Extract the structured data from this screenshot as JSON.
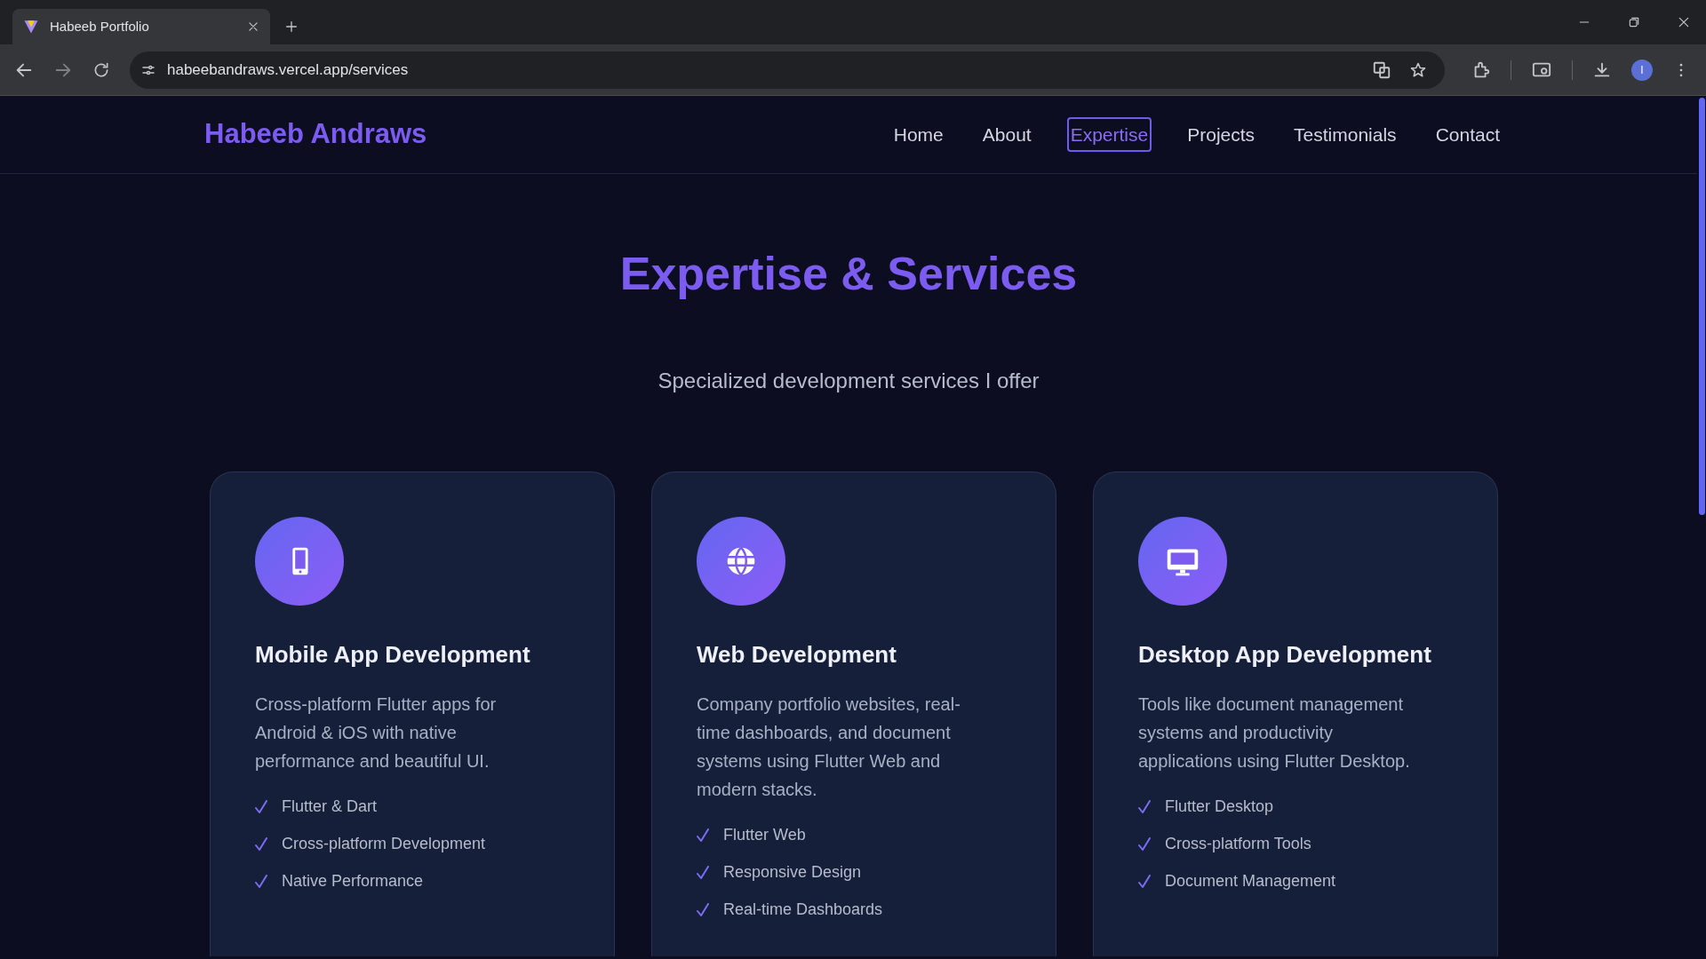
{
  "browser": {
    "tab": {
      "title": "Habeeb Portfolio",
      "selected": true
    },
    "url": "habeebandraws.vercel.app/services",
    "profile_initial": "I"
  },
  "site": {
    "logo": "Habeeb Andraws",
    "nav": [
      {
        "label": "Home",
        "selected": false
      },
      {
        "label": "About",
        "selected": false
      },
      {
        "label": "Expertise",
        "selected": true
      },
      {
        "label": "Projects",
        "selected": false
      },
      {
        "label": "Testimonials",
        "selected": false
      },
      {
        "label": "Contact",
        "selected": false
      }
    ]
  },
  "section": {
    "title": "Expertise & Services",
    "subtitle": "Specialized development services I offer",
    "cards": [
      {
        "kind": "phone",
        "title": "Mobile App Development",
        "description": "Cross-platform Flutter apps for Android & iOS with native performance and beautiful UI.",
        "features": [
          "Flutter & Dart",
          "Cross-platform Development",
          "Native Performance"
        ]
      },
      {
        "kind": "globe",
        "title": "Web Development",
        "description": "Company portfolio websites, real-time dashboards, and document systems using Flutter Web and modern stacks.",
        "features": [
          "Flutter Web",
          "Responsive Design",
          "Real-time Dashboards"
        ]
      },
      {
        "kind": "monitor",
        "title": "Desktop App Development",
        "description": "Tools like document management systems and productivity applications using Flutter Desktop.",
        "features": [
          "Flutter Desktop",
          "Cross-platform Tools",
          "Document Management"
        ]
      }
    ]
  }
}
